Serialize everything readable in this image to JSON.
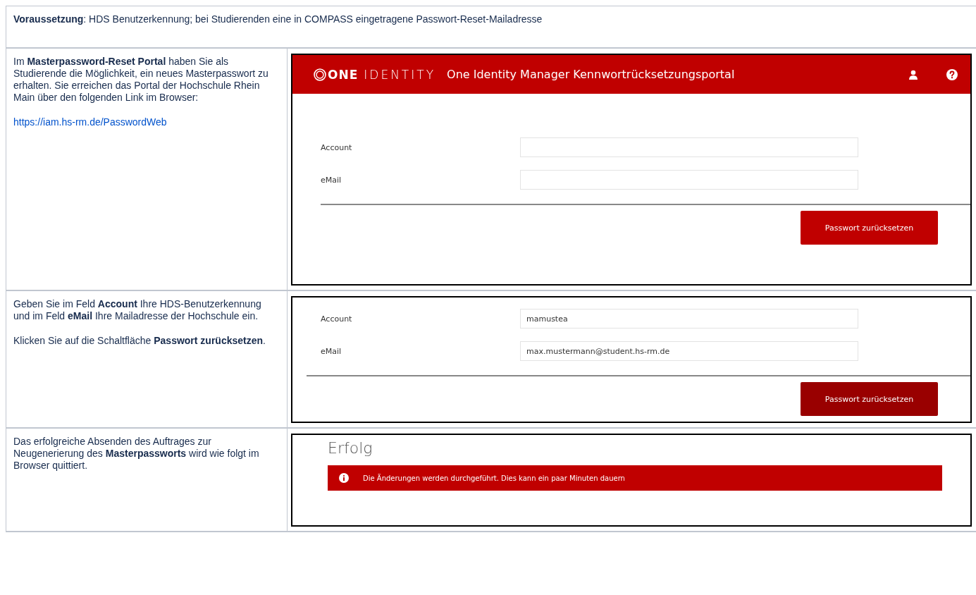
{
  "prerequisite": "**Voraussetzung**: HDS Benutzerkennung; bei Studierenden eine in COMPASS eingetragene Passwort-Reset-Mailadresse",
  "steps": [
    {
      "description": [
        {
          "kind": "text",
          "text": "Im **Masterpassword-Reset Portal** haben Sie als Studierende die Möglichkeit, ein neues Masterpasswort zu erhalten. Sie erreichen das Portal der Hochschule Rhein Main über den folgenden Link im Browser:"
        },
        {
          "kind": "link",
          "text": "https://iam.hs-rm.de/PasswordWeb"
        }
      ],
      "screen": {
        "kind": "form",
        "header": {
          "logo_bold": "ONE",
          "logo_light": "IDENTITY",
          "title": "One Identity Manager Kennwortrücksetzungsportal"
        },
        "fields": [
          {
            "label": "Account"
          },
          {
            "label": "eMail"
          }
        ],
        "button": {
          "label": "Passwort zurücksetzen",
          "pressed": false
        }
      }
    },
    {
      "description": [
        {
          "kind": "text",
          "text": "Geben Sie im Feld **Account** Ihre HDS-Benutzerkennung und im Feld **eMail** Ihre Mailadresse der Hochschule ein."
        },
        {
          "kind": "text",
          "text": "Klicken Sie auf die Schaltfläche **Passwort zurücksetzen**."
        }
      ],
      "screen": {
        "kind": "form",
        "fields": [
          {
            "label": "Account",
            "value": "mamustea"
          },
          {
            "label": "eMail",
            "value": "max.mustermann@student.hs-rm.de"
          }
        ],
        "button": {
          "label": "Passwort zurücksetzen",
          "pressed": true
        }
      }
    },
    {
      "description": [
        {
          "kind": "text",
          "text": "Das erfolgreiche Absenden des Auftrages zur Neugenerierung des **Masterpassworts** wird wie folgt im Browser quittiert."
        }
      ],
      "screen": {
        "kind": "success",
        "title": "Erfolg",
        "message": "Die Änderungen werden durchgeführt. Dies kann ein paar Minuten dauern"
      }
    }
  ]
}
